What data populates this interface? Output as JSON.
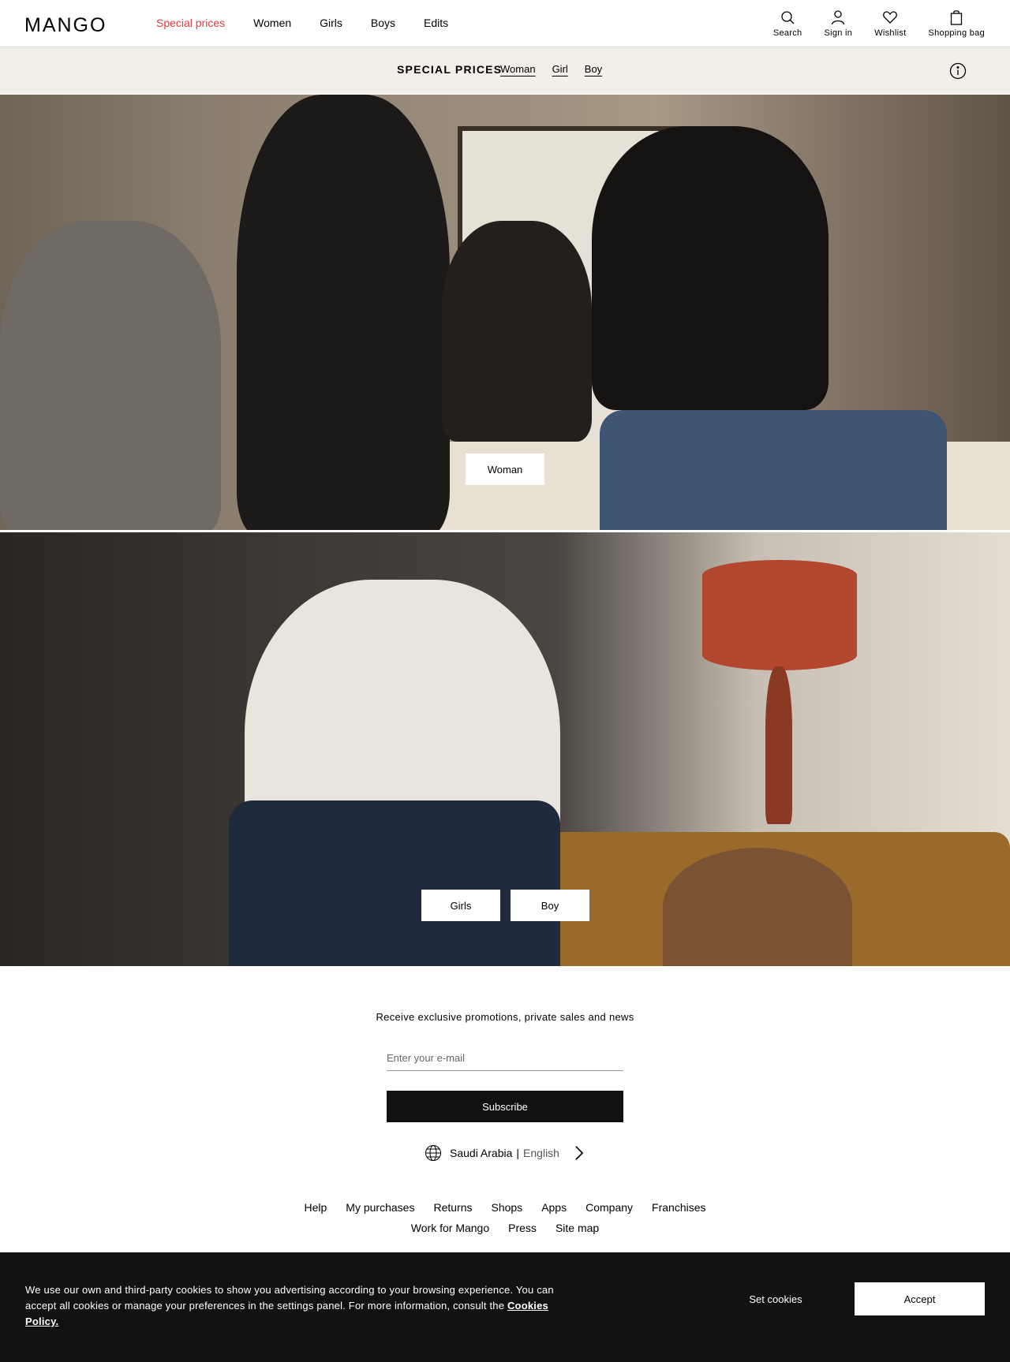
{
  "header": {
    "logo": "MANGO",
    "nav": [
      "Special prices",
      "Women",
      "Girls",
      "Boys",
      "Edits"
    ],
    "actions": {
      "search": "Search",
      "sign_in": "Sign in",
      "wishlist": "Wishlist",
      "bag": "Shopping bag"
    },
    "accent_color": "#e23a3a"
  },
  "subheader": {
    "title": "SPECIAL PRICES",
    "links": [
      "Woman",
      "Girl",
      "Boy"
    ]
  },
  "hero1": {
    "button": "Woman"
  },
  "hero2": {
    "buttons": [
      "Girls",
      "Boy"
    ]
  },
  "newsletter": {
    "text": "Receive exclusive promotions, private sales and news",
    "placeholder": "Enter your e-mail",
    "button": "Subscribe"
  },
  "locale": {
    "country": "Saudi Arabia",
    "separator": "|",
    "language": "English"
  },
  "footer": {
    "row1": [
      "Help",
      "My purchases",
      "Returns",
      "Shops",
      "Apps",
      "Company",
      "Franchises"
    ],
    "row2": [
      "Work for Mango",
      "Press",
      "Site map"
    ]
  },
  "cookie": {
    "text": "We use our own and third-party cookies to show you advertising according to your browsing experience. You can accept all cookies or manage your preferences in the settings panel. For more information, consult the",
    "policy_link": "Cookies Policy.",
    "set_cookies": "Set cookies",
    "accept": "Accept"
  }
}
